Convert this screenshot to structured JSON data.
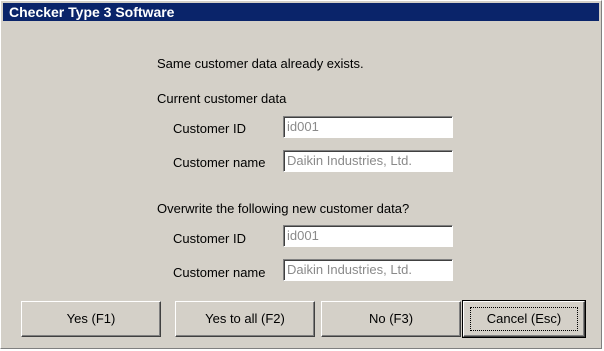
{
  "window": {
    "title": "Checker Type 3 Software"
  },
  "message": "Same customer data already exists.",
  "current": {
    "heading": "Current customer data",
    "id_label": "Customer ID",
    "id_value": "id001",
    "name_label": "Customer name",
    "name_value": "Daikin Industries, Ltd."
  },
  "new": {
    "heading": "Overwrite the following new customer data?",
    "id_label": "Customer ID",
    "id_value": "id001",
    "name_label": "Customer name",
    "name_value": "Daikin Industries, Ltd."
  },
  "buttons": {
    "yes": "Yes (F1)",
    "yes_to_all": "Yes to all (F2)",
    "no": "No (F3)",
    "cancel": "Cancel (Esc)"
  }
}
